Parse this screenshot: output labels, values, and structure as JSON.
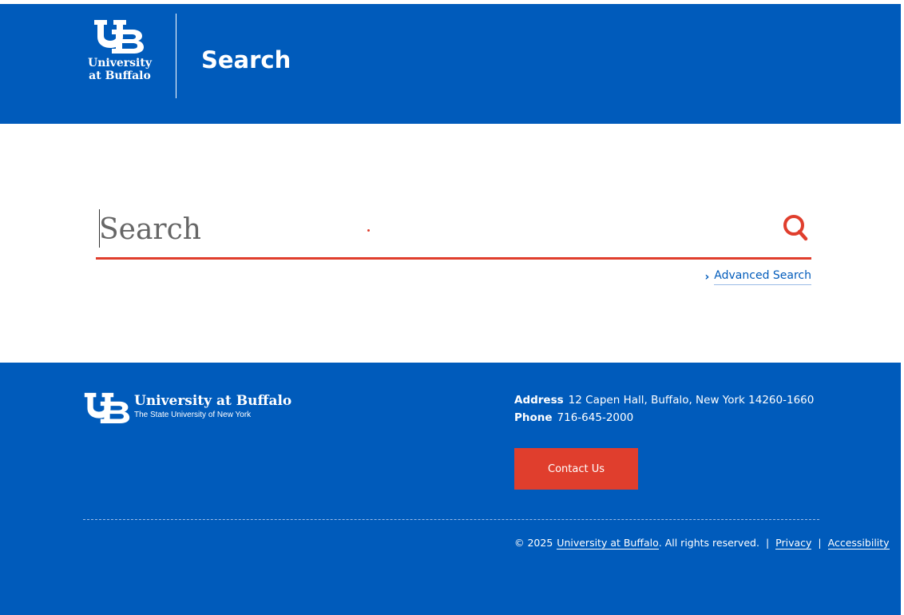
{
  "header": {
    "logo_line1": "University",
    "logo_line2": "at Buffalo",
    "title": "Search"
  },
  "search": {
    "placeholder": "Search",
    "advanced_label": "Advanced Search"
  },
  "footer": {
    "logo_name": "University at Buffalo",
    "logo_sub": "The State University of New York",
    "address_label": "Address",
    "address_value": "12 Capen Hall, Buffalo, New York 14260-1660",
    "phone_label": "Phone",
    "phone_value": "716-645-2000",
    "contact_button": "Contact Us",
    "copyright": "© 2025",
    "copyright_link": "University at Buffalo",
    "rights": ". All rights reserved.",
    "separator": "|",
    "privacy": "Privacy",
    "accessibility": "Accessibility"
  },
  "colors": {
    "brand_blue": "#005bbb",
    "accent_red": "#e03e2d",
    "white": "#ffffff"
  },
  "icons": {
    "search_button": "search-icon",
    "advanced_chevron": "chevron-right-icon"
  }
}
